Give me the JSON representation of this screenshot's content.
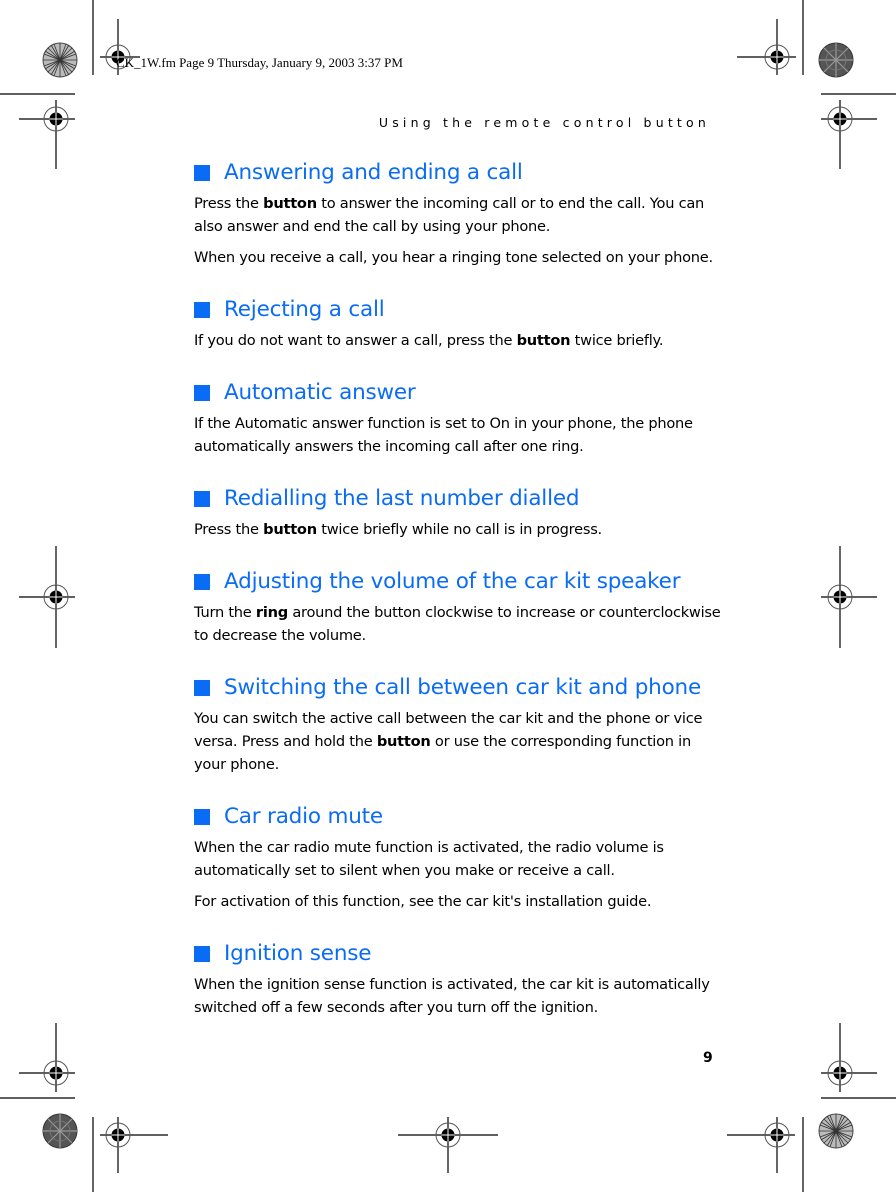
{
  "document": {
    "fm_header": "CK_1W.fm  Page 9  Thursday, January 9, 2003  3:37 PM",
    "running_head": "Using the remote control button",
    "page_number": "9",
    "accent_color": "#0a6cf5",
    "sections": [
      {
        "heading": "Answering and ending a call",
        "paragraphs": [
          [
            {
              "t": "Press the "
            },
            {
              "t": "button",
              "b": true
            },
            {
              "t": " to answer the incoming call or to end the call. You can also answer and end the call by using your phone."
            }
          ],
          [
            {
              "t": "When you receive a call, you hear a ringing tone selected on your phone."
            }
          ]
        ]
      },
      {
        "heading": "Rejecting a call",
        "paragraphs": [
          [
            {
              "t": "If you do not want to answer a call, press the "
            },
            {
              "t": "button",
              "b": true
            },
            {
              "t": " twice briefly."
            }
          ]
        ]
      },
      {
        "heading": "Automatic answer",
        "paragraphs": [
          [
            {
              "t": "If the Automatic answer function is set to On in your phone, the phone automatically answers the incoming call after one ring."
            }
          ]
        ]
      },
      {
        "heading": "Redialling the last number dialled",
        "paragraphs": [
          [
            {
              "t": "Press the "
            },
            {
              "t": "button",
              "b": true
            },
            {
              "t": " twice briefly while no call is in progress."
            }
          ]
        ]
      },
      {
        "heading": "Adjusting the volume of the car kit speaker",
        "paragraphs": [
          [
            {
              "t": "Turn the "
            },
            {
              "t": "ring",
              "b": true
            },
            {
              "t": " around the button clockwise to increase or counterclockwise to decrease the volume."
            }
          ]
        ]
      },
      {
        "heading": "Switching the call between car kit and phone",
        "paragraphs": [
          [
            {
              "t": "You can switch the active call between the car kit and the phone or vice versa. Press and hold the "
            },
            {
              "t": "button",
              "b": true
            },
            {
              "t": " or use the corresponding function in your phone."
            }
          ]
        ]
      },
      {
        "heading": "Car radio mute",
        "paragraphs": [
          [
            {
              "t": "When the car radio mute function is activated, the radio volume is automatically set to silent when you make or receive a call."
            }
          ],
          [
            {
              "t": "For activation of this function, see the car kit's installation guide."
            }
          ]
        ]
      },
      {
        "heading": "Ignition sense",
        "paragraphs": [
          [
            {
              "t": "When the ignition sense function is activated, the car kit is automatically switched off a few seconds after you turn off the ignition."
            }
          ]
        ]
      }
    ]
  },
  "print_marks": {
    "registration_marks": [
      {
        "name": "reg-mark-top-left",
        "icon": "crosshair-registration-icon"
      },
      {
        "name": "reg-mark-top-left-outer",
        "icon": "crosshair-registration-icon"
      },
      {
        "name": "reg-mark-top-right",
        "icon": "crosshair-registration-icon"
      },
      {
        "name": "reg-mark-top-right-outer",
        "icon": "crosshair-registration-icon"
      },
      {
        "name": "reg-mark-mid-left",
        "icon": "crosshair-registration-icon"
      },
      {
        "name": "reg-mark-mid-right",
        "icon": "crosshair-registration-icon"
      },
      {
        "name": "reg-mark-bottom-left-outer",
        "icon": "crosshair-registration-icon"
      },
      {
        "name": "reg-mark-bottom-left",
        "icon": "crosshair-registration-icon"
      },
      {
        "name": "reg-mark-bottom-center",
        "icon": "crosshair-registration-icon"
      },
      {
        "name": "reg-mark-bottom-right",
        "icon": "crosshair-registration-icon"
      },
      {
        "name": "reg-mark-bottom-right-outer",
        "icon": "crosshair-registration-icon"
      }
    ],
    "star_targets": [
      {
        "name": "star-target-top-left",
        "icon": "starburst-target-icon"
      },
      {
        "name": "star-target-top-right",
        "icon": "starburst-target-icon"
      },
      {
        "name": "star-target-bottom-left",
        "icon": "starburst-target-icon"
      },
      {
        "name": "star-target-bottom-right",
        "icon": "starburst-target-icon"
      }
    ]
  }
}
